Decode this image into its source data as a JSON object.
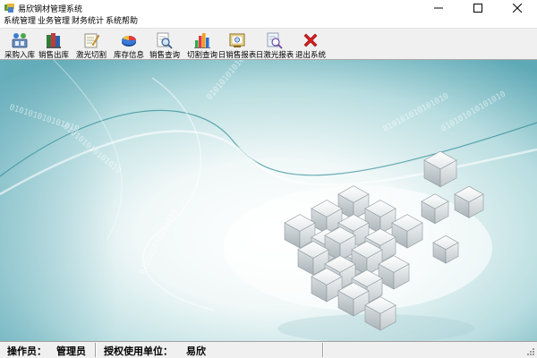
{
  "window": {
    "title": "易欣钢材管理系统"
  },
  "menu": {
    "items": [
      {
        "label": "系统管理"
      },
      {
        "label": "业务管理"
      },
      {
        "label": "财务统计"
      },
      {
        "label": "系统帮助"
      }
    ]
  },
  "toolbar": {
    "buttons": [
      {
        "label": "采购入库",
        "icon": "purchase-icon"
      },
      {
        "label": "销售出库",
        "icon": "books-icon"
      },
      {
        "label": "激光切割",
        "icon": "document-edit-icon"
      },
      {
        "label": "库存信息",
        "icon": "pie-chart-icon"
      },
      {
        "label": "销售查询",
        "icon": "magnifier-document-icon"
      },
      {
        "label": "切割查询",
        "icon": "bar-chart-icon"
      },
      {
        "label": "日销售报表",
        "icon": "report-frame-icon"
      },
      {
        "label": "日激光报表",
        "icon": "magnifier-report-icon"
      },
      {
        "label": "退出系统",
        "icon": "red-x-icon"
      }
    ]
  },
  "background": {
    "binary_text": "010101010101010"
  },
  "status": {
    "operator_label": "操作员：",
    "operator_value": "管理员",
    "unit_label": "授权使用单位：",
    "unit_value": "易欣"
  },
  "colors": {
    "toolbar_bg": "#f0f0f0",
    "accent_teal": "#3f9aa8",
    "exit_red": "#d81e1e"
  }
}
